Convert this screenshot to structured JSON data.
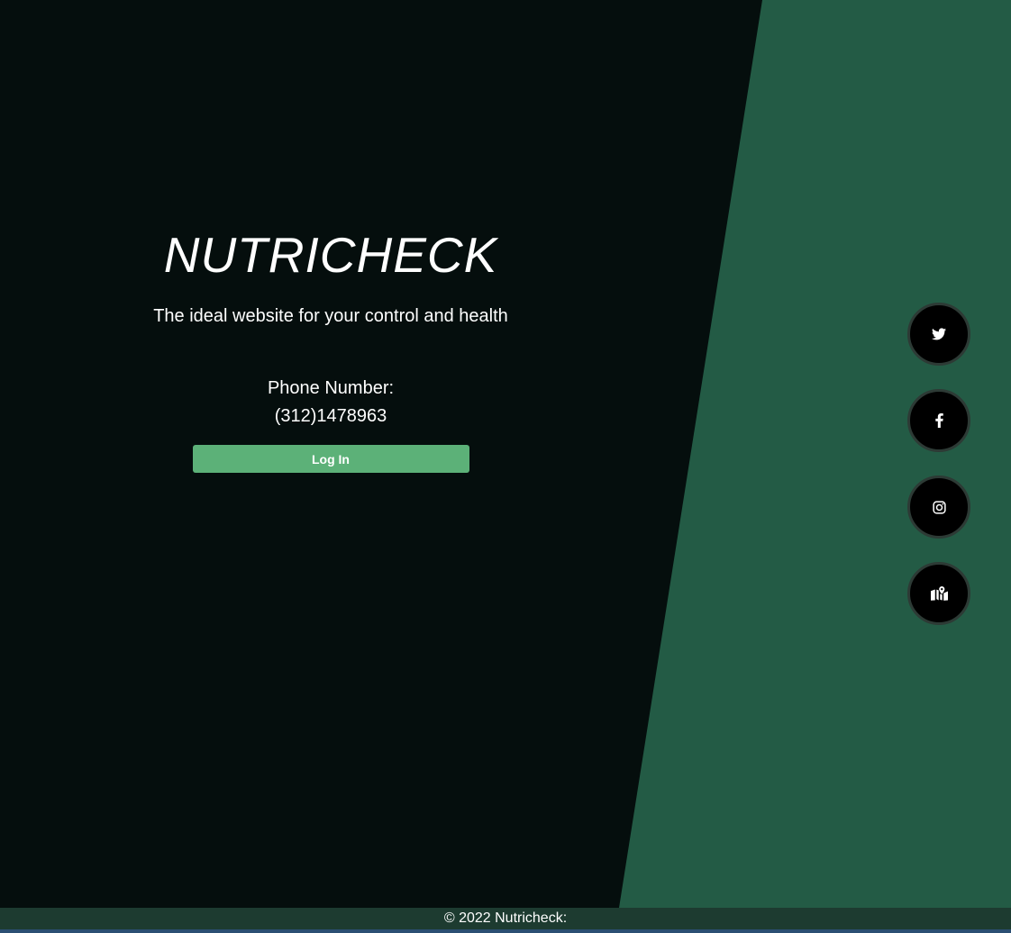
{
  "hero": {
    "title": "NUTRICHECK",
    "tagline": "The ideal website for your control and health",
    "phone_label": "Phone Number:",
    "phone_number": "(312)1478963",
    "login_label": "Log In"
  },
  "social": [
    {
      "icon": "twitter-icon"
    },
    {
      "icon": "facebook-icon"
    },
    {
      "icon": "instagram-icon"
    },
    {
      "icon": "map-icon"
    }
  ],
  "footer": {
    "text": "© 2022 Nutricheck:"
  },
  "colors": {
    "background": "#050e0d",
    "panel_green": "#235b45",
    "button_green": "#5cb178",
    "footer": "#1d3b30"
  }
}
